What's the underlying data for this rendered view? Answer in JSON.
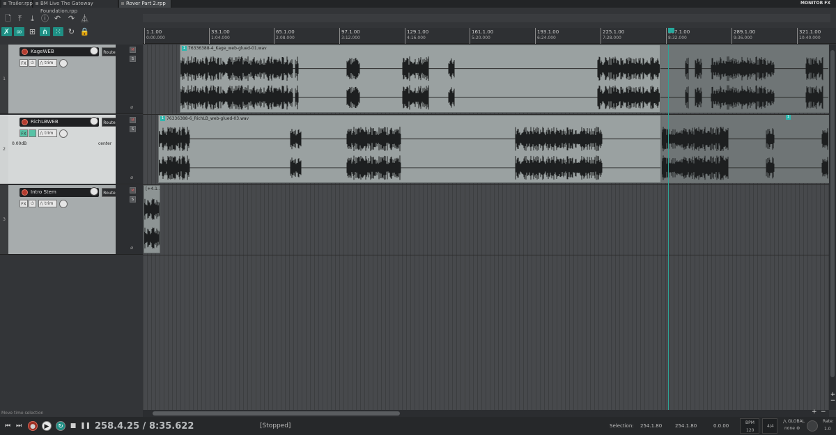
{
  "project_tabs": [
    "Trailer.rpp",
    "BM Live The Gateway Foundation.rpp",
    "Rover Part 2.rpp"
  ],
  "monitor_fx_label": "MONITOR FX",
  "ruler": {
    "marks": [
      {
        "measure": "1.1.00",
        "time": "0:00.000"
      },
      {
        "measure": "33.1.00",
        "time": "1:04.000"
      },
      {
        "measure": "65.1.00",
        "time": "2:08.000"
      },
      {
        "measure": "97.1.00",
        "time": "3:12.000"
      },
      {
        "measure": "129.1.00",
        "time": "4:16.000"
      },
      {
        "measure": "161.1.00",
        "time": "5:20.000"
      },
      {
        "measure": "193.1.00",
        "time": "6:24.000"
      },
      {
        "measure": "225.1.00",
        "time": "7:28.000"
      },
      {
        "measure": "257.1.00",
        "time": "8:32.000"
      },
      {
        "measure": "289.1.00",
        "time": "9:36.000"
      },
      {
        "measure": "321.1.00",
        "time": "10:40.000"
      }
    ]
  },
  "tracks": [
    {
      "number": "1",
      "name": "KageWEB",
      "route_label": "Route",
      "fx_label": "FX",
      "trim_label": "trim",
      "mute_label": "M",
      "solo_label": "S",
      "vol_readout": "",
      "pan_readout": "",
      "selected": false,
      "items": [
        {
          "label": "76336388-4_Kage_web-glued-01.wav",
          "badge": "1"
        }
      ]
    },
    {
      "number": "2",
      "name": "RichLBWEB",
      "route_label": "Route",
      "fx_label": "FX",
      "trim_label": "trim",
      "mute_label": "M",
      "solo_label": "S",
      "vol_readout": "0.00dB",
      "pan_readout": "center",
      "selected": true,
      "items": [
        {
          "label": "76336388-6_RichLB_web-glued-03.wav",
          "badge": "1"
        },
        {
          "label": "",
          "badge": "1"
        }
      ]
    },
    {
      "number": "3",
      "name": "Intro Stem",
      "route_label": "Route",
      "fx_label": "FX",
      "trim_label": "trim",
      "mute_label": "M",
      "solo_label": "S",
      "vol_readout": "",
      "pan_readout": "",
      "selected": false,
      "items": [
        {
          "label": "[+4.1...",
          "badge": ""
        }
      ]
    }
  ],
  "status_hint": "Move time selection",
  "transport": {
    "position": "258.4.25 / 8:35.622",
    "state": "[Stopped]",
    "selection_label": "Selection:",
    "selection_start": "254.1.80",
    "selection_end": "254.1.80",
    "selection_length": "0.0.00",
    "bpm_label": "BPM",
    "bpm_value": "120",
    "time_sig": "4/4",
    "global_label": "GLOBAL",
    "global_value": "none",
    "rate_label": "Rate:",
    "rate_value": "1.0"
  },
  "colors": {
    "accent": "#1f8f84",
    "item": "#9aa1a1",
    "record": "#b33b2e",
    "playhead": "#2ea396"
  },
  "icons": [
    "new-project-icon",
    "open-project-icon",
    "save-project-icon",
    "project-settings-icon",
    "undo-icon",
    "redo-icon",
    "metronome-icon",
    "ripple-edit-icon",
    "link-icon",
    "grid-icon",
    "snap-icon",
    "loop-icon",
    "lock-icon"
  ]
}
